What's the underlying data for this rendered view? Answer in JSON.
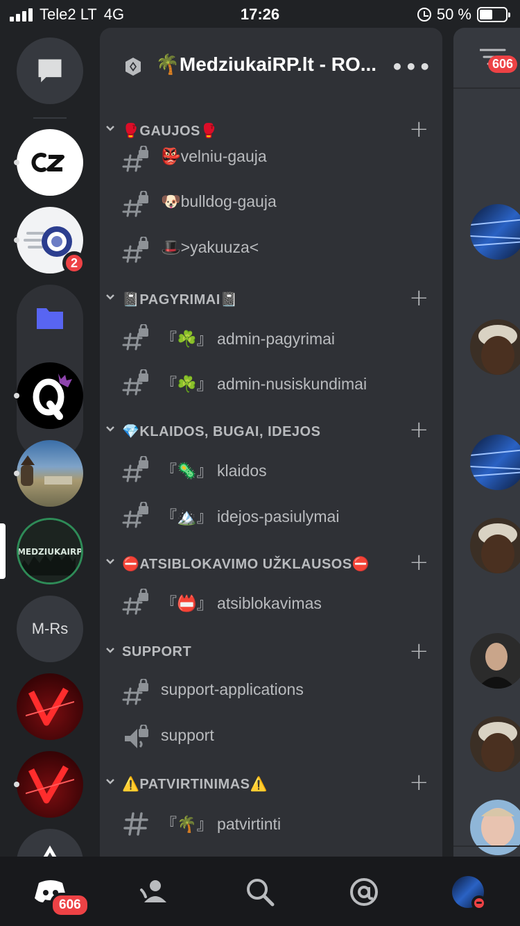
{
  "status_bar": {
    "carrier": "Tele2 LT",
    "network": "4G",
    "time": "17:26",
    "battery": "50 %",
    "battery_level": 0.5
  },
  "server_rail": {
    "dm_icon": "chat-bubble-icon",
    "servers": [
      {
        "label": "CZ",
        "unread": true
      },
      {
        "label": "",
        "unread": true,
        "badge": "2"
      },
      {
        "label": "",
        "type": "folder",
        "color": "#5865f2"
      },
      {
        "label": "Q",
        "unread": true
      },
      {
        "label": "",
        "unread": true
      },
      {
        "label": "MEDZIUKAIRP",
        "selected": true
      },
      {
        "label": "M-Rs",
        "unread": false
      },
      {
        "label": "",
        "unread": false
      },
      {
        "label": "",
        "unread": true
      },
      {
        "label": "",
        "unread": false
      }
    ]
  },
  "header": {
    "server_name": "🌴MedziukaiRP.lt - RO...",
    "more": "•••"
  },
  "categories": [
    {
      "label": "🥊GAUJOS🥊",
      "channels": [
        {
          "name": "👺velniu-gauja",
          "icon": "locked-text-channel-icon"
        },
        {
          "name": "🐶bulldog-gauja",
          "icon": "locked-text-channel-icon"
        },
        {
          "name": "🎩>yakuuza<",
          "icon": "locked-text-channel-icon"
        }
      ]
    },
    {
      "label": "📓PAGYRIMAI📓",
      "channels": [
        {
          "name": "『☘️』 admin-pagyrimai",
          "icon": "locked-text-channel-icon"
        },
        {
          "name": "『☘️』 admin-nusiskundimai",
          "icon": "locked-text-channel-icon"
        }
      ]
    },
    {
      "label": "💎KLAIDOS, BUGAI, IDEJOS",
      "channels": [
        {
          "name": "『🦠』 klaidos",
          "icon": "locked-text-channel-icon"
        },
        {
          "name": "『🏔️』 idejos-pasiulymai",
          "icon": "locked-text-channel-icon"
        }
      ]
    },
    {
      "label": "⛔ATSIBLOKAVIMO UŽKLAUSOS⛔",
      "channels": [
        {
          "name": "『📛』 atsiblokavimas",
          "icon": "locked-text-channel-icon"
        }
      ]
    },
    {
      "label": "SUPPORT",
      "channels": [
        {
          "name": "support-applications",
          "icon": "locked-text-channel-icon"
        },
        {
          "name": "support",
          "icon": "locked-voice-channel-icon"
        }
      ]
    },
    {
      "label": "⚠️PATVIRTINIMAS⚠️",
      "channels": [
        {
          "name": "『🌴』 patvirtinti",
          "icon": "text-channel-icon"
        }
      ]
    }
  ],
  "peek": {
    "badge": "606"
  },
  "tabbar": {
    "home_badge": "606",
    "tabs": [
      "home-icon",
      "friends-icon",
      "search-icon",
      "mentions-icon",
      "profile-avatar"
    ]
  },
  "colors": {
    "accent": "#5865f2",
    "badge": "#ed4245",
    "rail_bg": "#202225",
    "channel_bg": "#2f3136"
  }
}
